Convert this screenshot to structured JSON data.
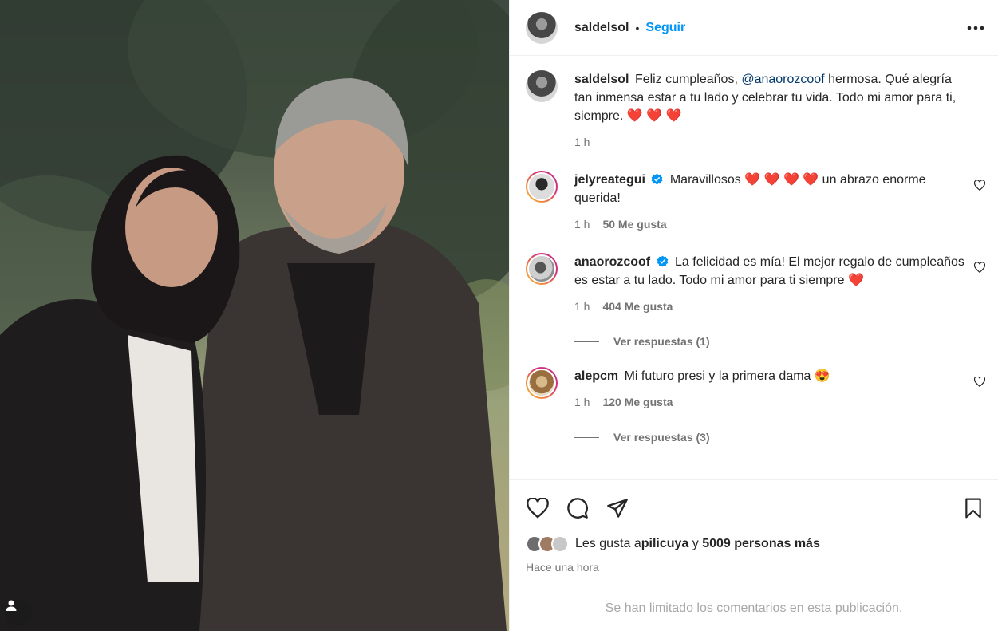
{
  "post": {
    "author": "saldelsol",
    "follow_label": "Seguir",
    "separator": "•",
    "caption_pre": "Feliz cumpleaños, ",
    "caption_mention": "@anaorozcoof",
    "caption_post": " hermosa. Qué alegría tan inmensa estar a tu lado y celebrar tu vida. Todo mi amor para ti, siempre. ",
    "caption_hearts": "❤️ ❤️ ❤️",
    "caption_time": "1 h"
  },
  "comments": [
    {
      "username": "jelyreategui",
      "verified": true,
      "text_a": "Maravillosos ",
      "hearts": "❤️ ❤️ ❤️ ❤️",
      "text_b": " un abrazo enorme querida!",
      "time": "1 h",
      "likes": "50 Me gusta"
    },
    {
      "username": "anaorozcoof",
      "verified": true,
      "text_a": "La felicidad es mía! El mejor regalo de cumpleaños es estar a tu lado. Todo mi amor para ti siempre ",
      "hearts": "❤️",
      "time": "1 h",
      "likes": "404 Me gusta",
      "replies": "Ver respuestas (1)"
    },
    {
      "username": "alepcm",
      "verified": false,
      "text_a": "Mi futuro presi y la primera dama ",
      "emoji": "😍",
      "time": "1 h",
      "likes": "120 Me gusta",
      "replies": "Ver respuestas (3)"
    }
  ],
  "likes_summary": {
    "prefix": "Les gusta a ",
    "user": "pilicuya",
    "conjunction": " y ",
    "others": "5009 personas más"
  },
  "post_time": "Hace una hora",
  "comments_limited": "Se han limitado los comentarios en esta publicación.",
  "colors": {
    "accent": "#0095f6",
    "heart": "#ed1c24",
    "muted": "#737373"
  }
}
